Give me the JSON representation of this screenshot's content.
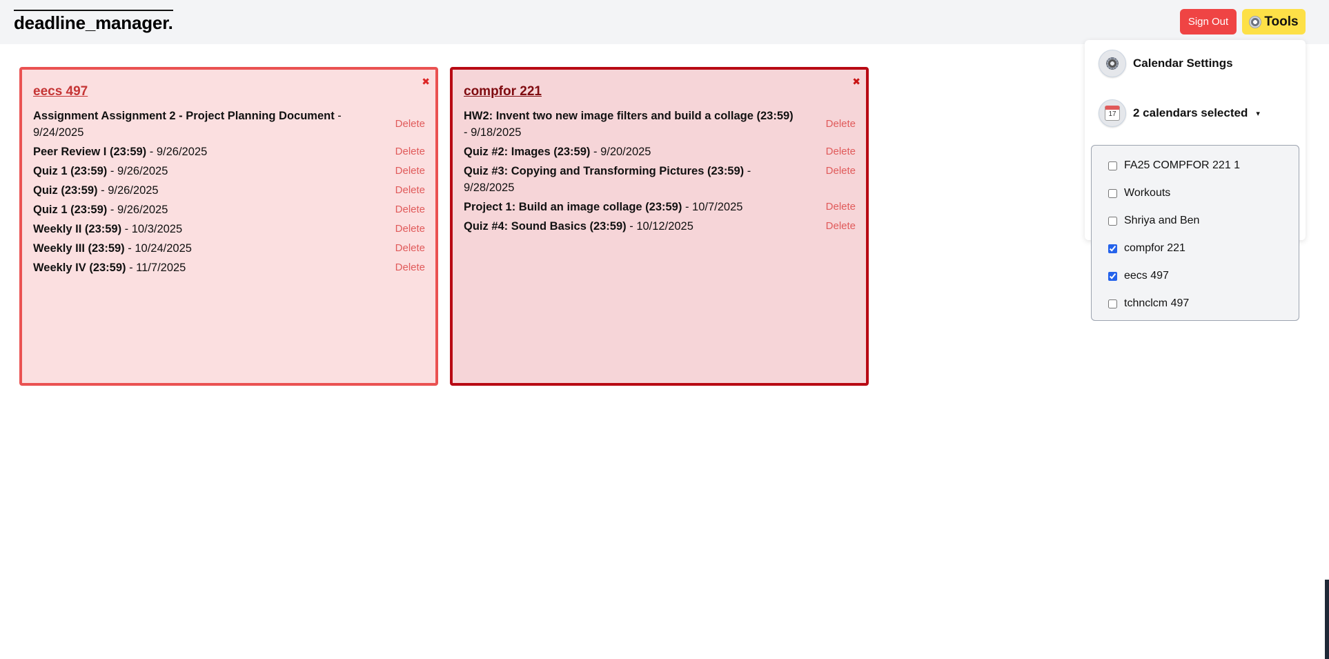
{
  "header": {
    "brand": "deadline_manager.",
    "sign_out_label": "Sign Out",
    "tools_label": "Tools"
  },
  "cards": [
    {
      "title": "eecs 497",
      "close_glyph": "✖",
      "items": [
        {
          "name": "Assignment Assignment 2 - Project Planning Document",
          "date": " - 9/24/2025",
          "delete": "Delete"
        },
        {
          "name": "Peer Review I (23:59)",
          "date": " - 9/26/2025",
          "delete": "Delete"
        },
        {
          "name": "Quiz 1 (23:59)",
          "date": " - 9/26/2025",
          "delete": "Delete"
        },
        {
          "name": "Quiz (23:59)",
          "date": " - 9/26/2025",
          "delete": "Delete"
        },
        {
          "name": "Quiz 1 (23:59)",
          "date": " - 9/26/2025",
          "delete": "Delete"
        },
        {
          "name": "Weekly II (23:59)",
          "date": " - 10/3/2025",
          "delete": "Delete"
        },
        {
          "name": "Weekly III (23:59)",
          "date": " - 10/24/2025",
          "delete": "Delete"
        },
        {
          "name": "Weekly IV (23:59)",
          "date": " - 11/7/2025",
          "delete": "Delete"
        }
      ]
    },
    {
      "title": "compfor 221",
      "close_glyph": "✖",
      "items": [
        {
          "name": "HW2: Invent two new image filters and build a collage (23:59)",
          "date": " - 9/18/2025",
          "delete": "Delete"
        },
        {
          "name": "Quiz #2: Images (23:59)",
          "date": " - 9/20/2025",
          "delete": "Delete"
        },
        {
          "name": "Quiz #3: Copying and Transforming Pictures (23:59)",
          "date": " - 9/28/2025",
          "delete": "Delete"
        },
        {
          "name": "Project 1: Build an image collage (23:59)",
          "date": " - 10/7/2025",
          "delete": "Delete"
        },
        {
          "name": "Quiz #4: Sound Basics (23:59)",
          "date": " - 10/12/2025",
          "delete": "Delete"
        }
      ]
    }
  ],
  "tools_menu": {
    "settings_label": "Calendar Settings",
    "calendars_selected_label": "2 calendars selected",
    "caret": "▾",
    "calendar_icon_text": "17",
    "calendars": [
      {
        "label": "FA25 COMPFOR 221 1",
        "checked": false
      },
      {
        "label": "Workouts",
        "checked": false
      },
      {
        "label": "Shriya and Ben",
        "checked": false
      },
      {
        "label": "compfor 221",
        "checked": true
      },
      {
        "label": "eecs 497",
        "checked": true
      },
      {
        "label": "tchnclcm 497",
        "checked": false
      }
    ]
  },
  "colors": {
    "sign_out_bg": "#ef4444",
    "tools_bg": "#fde047",
    "card1_border": "#ea5252",
    "card2_border": "#b80a14",
    "delete_text": "#e05a5a"
  }
}
